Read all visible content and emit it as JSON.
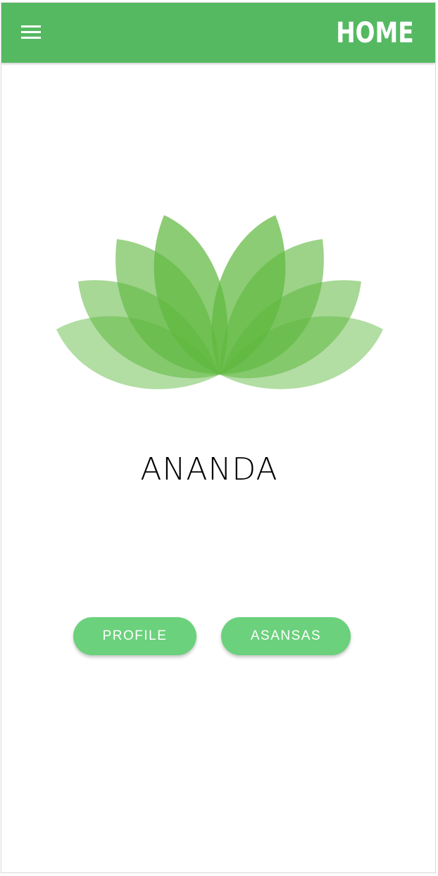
{
  "header": {
    "title": "HOME",
    "menu_icon": "hamburger-menu-icon",
    "background_color": "#55b962"
  },
  "main": {
    "logo_icon": "lotus-logo-icon",
    "brand_name": "ANANDA",
    "buttons": {
      "profile_label": "PROFILE",
      "asansas_label": "ASANSAS"
    },
    "button_color": "#6bd17c",
    "leaf_color": "#5fb83f"
  }
}
